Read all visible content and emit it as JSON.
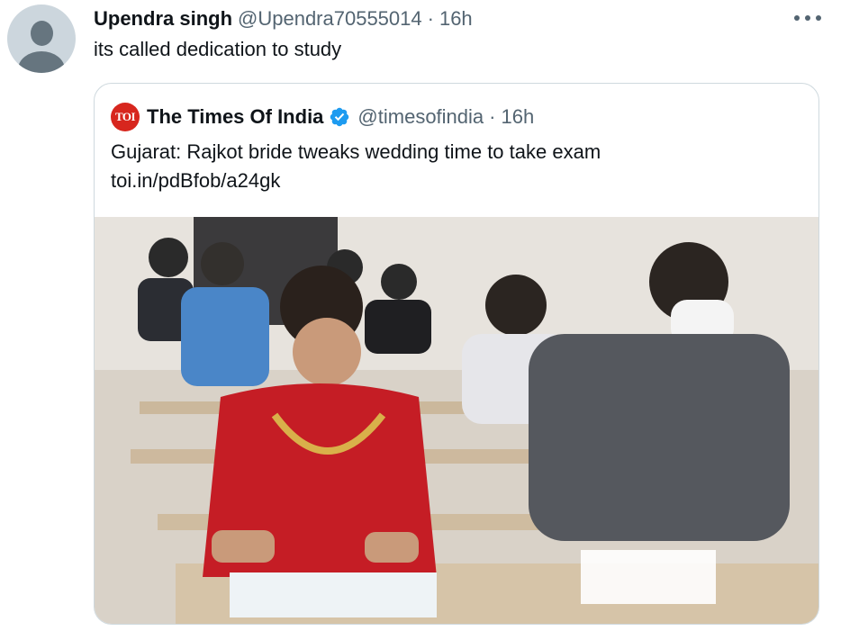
{
  "tweet": {
    "author_name": "Upendra singh",
    "author_handle": "@Upendra70555014",
    "separator": "·",
    "time": "16h",
    "text": "its called dedication to study"
  },
  "quoted_tweet": {
    "logo_text": "TOI",
    "author_name": "The Times Of India",
    "author_handle": "@timesofindia",
    "separator": "·",
    "time": "16h",
    "text_line1": "Gujarat: Rajkot bride tweaks wedding time to take exam",
    "text_line2": "toi.in/pdBfob/a24gk"
  },
  "colors": {
    "text_primary": "#0f1419",
    "text_secondary": "#536471",
    "verified_blue": "#1d9bf0",
    "toi_red": "#d7261e",
    "card_border": "#cfd9de"
  },
  "icons": {
    "more": "more-horizontal-icon",
    "verified": "verified-badge-icon",
    "avatar": "default-avatar-icon"
  }
}
